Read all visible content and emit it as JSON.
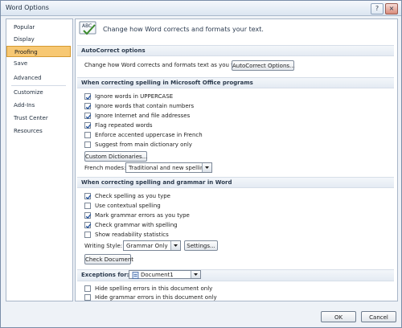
{
  "window": {
    "title": "Word Options",
    "help_glyph": "?",
    "close_glyph": "×"
  },
  "sidebar": {
    "items": [
      {
        "label": "Popular"
      },
      {
        "label": "Display"
      },
      {
        "label": "Proofing"
      },
      {
        "label": "Save"
      },
      {
        "label": "Advanced"
      },
      {
        "label": "Customize"
      },
      {
        "label": "Add-Ins"
      },
      {
        "label": "Trust Center"
      },
      {
        "label": "Resources"
      }
    ],
    "active_index": 2
  },
  "header": {
    "text": "Change how Word corrects and formats your text.",
    "icon": "abc-check-icon"
  },
  "autocorrect": {
    "title": "AutoCorrect options",
    "description": "Change how Word corrects and formats text as you type:",
    "button": "AutoCorrect Options..."
  },
  "office_spelling": {
    "title": "When correcting spelling in Microsoft Office programs",
    "options": [
      {
        "label": "Ignore words in UPPERCASE",
        "checked": true
      },
      {
        "label": "Ignore words that contain numbers",
        "checked": true
      },
      {
        "label": "Ignore Internet and file addresses",
        "checked": true
      },
      {
        "label": "Flag repeated words",
        "checked": true
      },
      {
        "label": "Enforce accented uppercase in French",
        "checked": false
      },
      {
        "label": "Suggest from main dictionary only",
        "checked": false
      }
    ],
    "custom_dictionaries_button": "Custom Dictionaries...",
    "french_modes_label": "French modes:",
    "french_modes_value": "Traditional and new spellings"
  },
  "word_spelling": {
    "title": "When correcting spelling and grammar in Word",
    "options": [
      {
        "label": "Check spelling as you type",
        "checked": true
      },
      {
        "label": "Use contextual spelling",
        "checked": false
      },
      {
        "label": "Mark grammar errors as you type",
        "checked": true
      },
      {
        "label": "Check grammar with spelling",
        "checked": true
      },
      {
        "label": "Show readability statistics",
        "checked": false
      }
    ],
    "writing_style_label": "Writing Style:",
    "writing_style_value": "Grammar Only",
    "settings_button": "Settings...",
    "check_document_button": "Check Document"
  },
  "exceptions": {
    "label": "Exceptions for:",
    "document_value": "Document1",
    "options": [
      {
        "label": "Hide spelling errors in this document only",
        "checked": false
      },
      {
        "label": "Hide grammar errors in this document only",
        "checked": false
      }
    ]
  },
  "footer": {
    "ok": "OK",
    "cancel": "Cancel"
  }
}
